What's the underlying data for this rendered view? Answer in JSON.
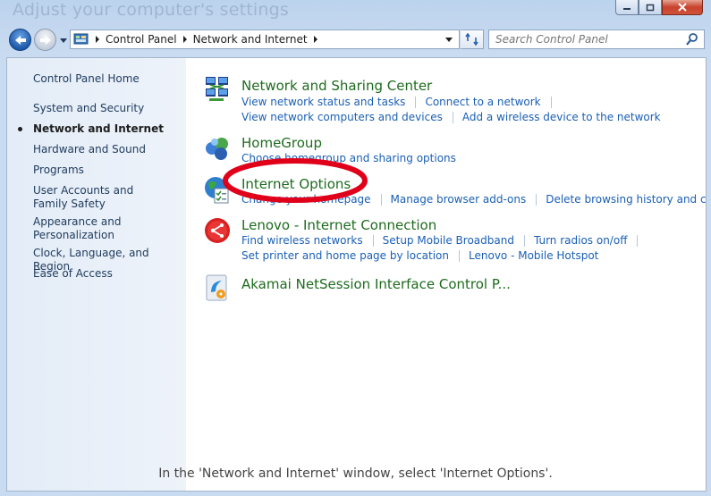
{
  "window": {
    "title": "Adjust your computer's settings"
  },
  "address": {
    "crumbs": [
      "Control Panel",
      "Network and Internet"
    ]
  },
  "search": {
    "placeholder": "Search Control Panel"
  },
  "sidebar": {
    "home": "Control Panel Home",
    "items": [
      {
        "label": "System and Security"
      },
      {
        "label": "Network and Internet",
        "active": true
      },
      {
        "label": "Hardware and Sound"
      },
      {
        "label": "Programs"
      },
      {
        "label": "User Accounts and Family Safety"
      },
      {
        "label": "Appearance and Personalization"
      },
      {
        "label": "Clock, Language, and Region"
      },
      {
        "label": "Ease of Access"
      }
    ]
  },
  "categories": [
    {
      "title": "Network and Sharing Center",
      "icon": "network-sharing-icon",
      "tasks": [
        [
          "View network status and tasks",
          "Connect to a network"
        ],
        [
          "View network computers and devices",
          "Add a wireless device to the network"
        ]
      ]
    },
    {
      "title": "HomeGroup",
      "icon": "homegroup-icon",
      "tasks": [
        [
          "Choose homegroup and sharing options"
        ]
      ]
    },
    {
      "title": "Internet Options",
      "icon": "internet-options-icon",
      "tasks": [
        [
          "Change your homepage",
          "Manage browser add-ons",
          "Delete browsing history and cookies"
        ]
      ]
    },
    {
      "title": "Lenovo - Internet Connection",
      "icon": "lenovo-connection-icon",
      "tasks": [
        [
          "Find wireless networks",
          "Setup Mobile Broadband",
          "Turn radios on/off"
        ],
        [
          "Set printer and home page by location",
          "Lenovo - Mobile Hotspot"
        ]
      ]
    },
    {
      "title": "Akamai NetSession Interface Control P...",
      "icon": "akamai-icon",
      "tasks": []
    }
  ],
  "caption": "In the 'Network and Internet' window, select 'Internet Options'.",
  "colors": {
    "category_title": "#1d6b1d",
    "task_link": "#1a5fb4",
    "highlight": "#e0001a"
  }
}
